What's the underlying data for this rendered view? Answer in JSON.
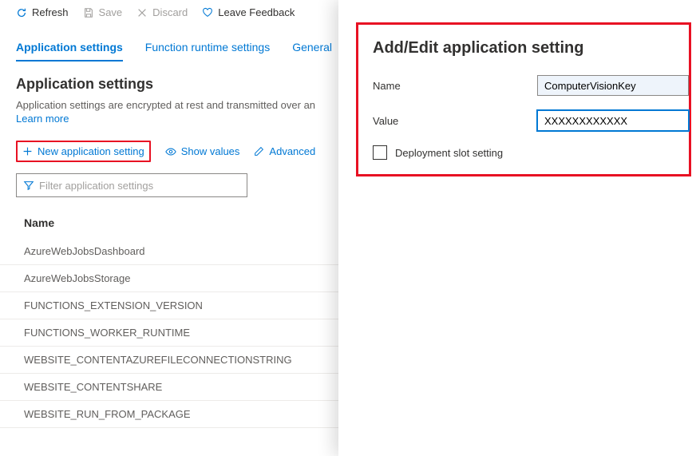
{
  "toolbar": {
    "refresh": "Refresh",
    "save": "Save",
    "discard": "Discard",
    "feedback": "Leave Feedback"
  },
  "tabs": {
    "app_settings": "Application settings",
    "runtime": "Function runtime settings",
    "general": "General"
  },
  "section": {
    "title": "Application settings",
    "desc": "Application settings are encrypted at rest and transmitted over an",
    "learn_more": "Learn more"
  },
  "actions": {
    "new_setting": "New application setting",
    "show_values": "Show values",
    "advanced": "Advanced"
  },
  "filter": {
    "placeholder": "Filter application settings"
  },
  "table": {
    "header_name": "Name",
    "rows": [
      "AzureWebJobsDashboard",
      "AzureWebJobsStorage",
      "FUNCTIONS_EXTENSION_VERSION",
      "FUNCTIONS_WORKER_RUNTIME",
      "WEBSITE_CONTENTAZUREFILECONNECTIONSTRING",
      "WEBSITE_CONTENTSHARE",
      "WEBSITE_RUN_FROM_PACKAGE"
    ]
  },
  "panel": {
    "title": "Add/Edit application setting",
    "name_label": "Name",
    "name_value": "ComputerVisionKey",
    "value_label": "Value",
    "value_value": "XXXXXXXXXXXX",
    "deploy_slot": "Deployment slot setting"
  }
}
